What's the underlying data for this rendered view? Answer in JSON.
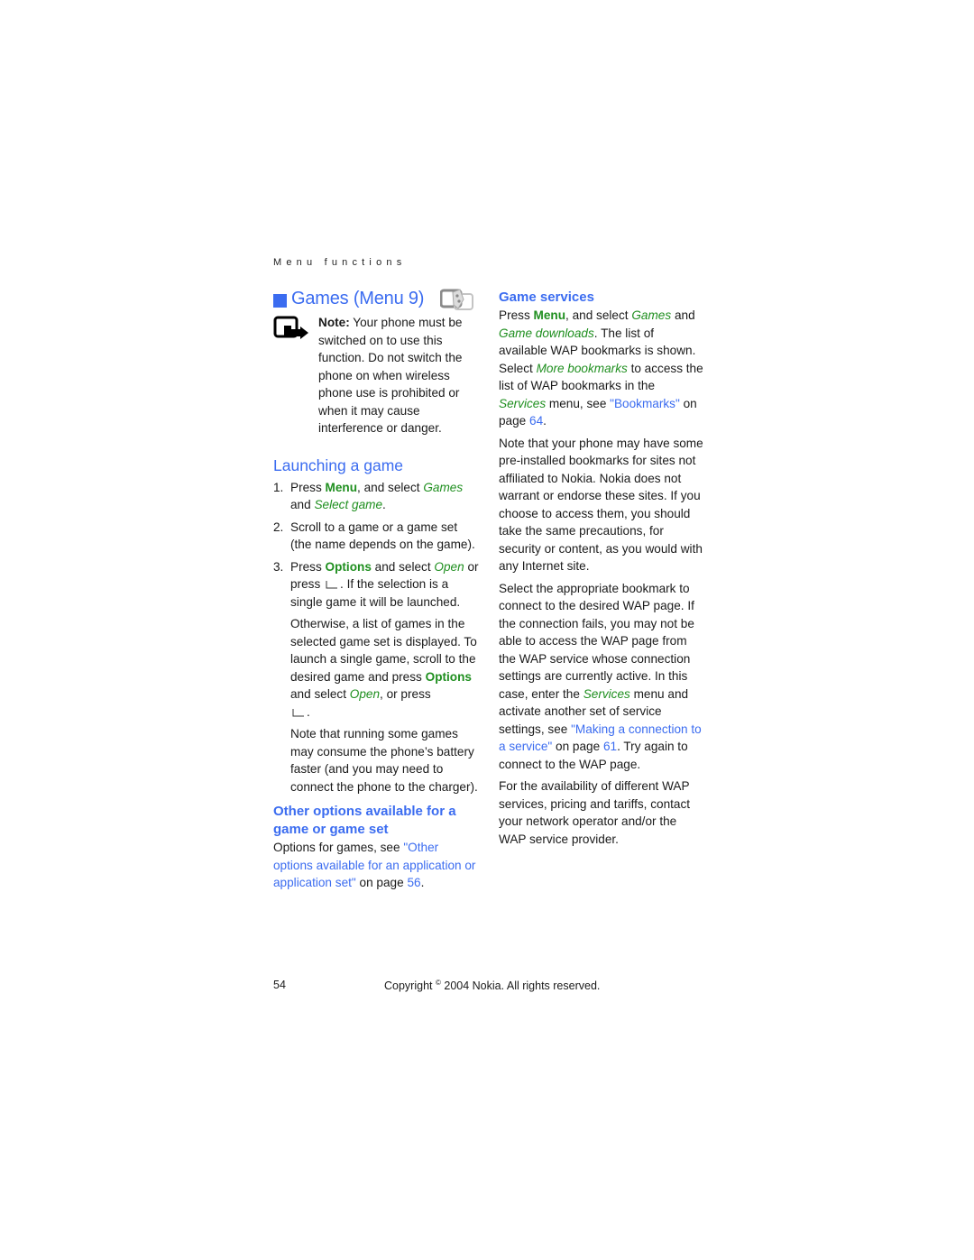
{
  "running_head": "Menu functions",
  "left": {
    "title": "Games (Menu 9)",
    "icons": {
      "title_square": "section-square-icon",
      "games": "games-menu-icon",
      "note": "note-hand-icon"
    },
    "note": {
      "label": "Note:",
      "text": " Your phone must be switched on to use this function. Do not switch the phone on when wireless phone use is prohibited or when it may cause interference or danger."
    },
    "launching": {
      "heading": "Launching a game",
      "steps": [
        {
          "num": "1.",
          "t1": "Press ",
          "k1": "Menu",
          "t2": ", and select ",
          "i1": "Games",
          "t3": " and ",
          "i2": "Select game",
          "t4": "."
        },
        {
          "num": "2.",
          "text": "Scroll to a game or a game set (the name depends on the game)."
        },
        {
          "num": "3.",
          "t1": "Press ",
          "k1": "Options",
          "t2": " and select ",
          "i1": "Open",
          "t3": " or press ",
          "t4": ". If the selection is a single game it will be launched."
        }
      ],
      "para_otherwise": {
        "t1": "Otherwise, a list of games in the selected game set is displayed. To launch a single game, scroll to the desired game and press ",
        "k1": "Options",
        "t2": " and select ",
        "i1": "Open",
        "t3": ", or press ",
        "t4": "."
      },
      "para_battery": "Note that running some games may consume the phone’s battery faster (and you may need to connect the phone to the charger)."
    },
    "other_options": {
      "heading": "Other options available for a game or game set",
      "t1": "Options for games, see ",
      "link": "\"Other options available for an application or application set\"",
      "t2": " on page ",
      "page": "56",
      "t3": "."
    }
  },
  "right": {
    "game_services": {
      "heading": "Game services",
      "p1": {
        "t1": "Press ",
        "k1": "Menu",
        "t2": ", and select ",
        "i1": "Games",
        "t3": " and ",
        "i2": "Game downloads",
        "t4": ". The list of available WAP bookmarks is shown. Select ",
        "i3": "More bookmarks",
        "t5": " to access the list of WAP bookmarks in the ",
        "i4": "Services",
        "t6": " menu, see ",
        "link": "\"Bookmarks\"",
        "t7": " on page ",
        "page": "64",
        "t8": "."
      },
      "p2": "Note that your phone may have some pre-installed bookmarks for sites not affiliated to Nokia. Nokia does not warrant or endorse these sites. If you choose to access them, you should take the same precautions, for security or content, as you would with any Internet site.",
      "p3": {
        "t1": "Select the appropriate bookmark to connect to the desired WAP page. If the connection fails, you may not be able to access the WAP page from the WAP service whose connection settings are currently active. In this case, enter the ",
        "i1": "Services",
        "t2": " menu and activate another set of service settings, see ",
        "link": "\"Making a connection to a service\"",
        "t3": " on page ",
        "page": "61",
        "t4": ". Try again to connect to the WAP page."
      },
      "p4": "For the availability of different WAP services, pricing and tariffs, contact your network operator and/or the WAP service provider."
    }
  },
  "footer": {
    "page_number": "54",
    "copyright_pre": "Copyright ",
    "copyright_symbol": "©",
    "copyright_post": " 2004 Nokia. All rights reserved."
  },
  "colors": {
    "heading_blue": "#3b6cf0",
    "menu_green": "#1f8f1f",
    "text": "#1a1a1a"
  }
}
